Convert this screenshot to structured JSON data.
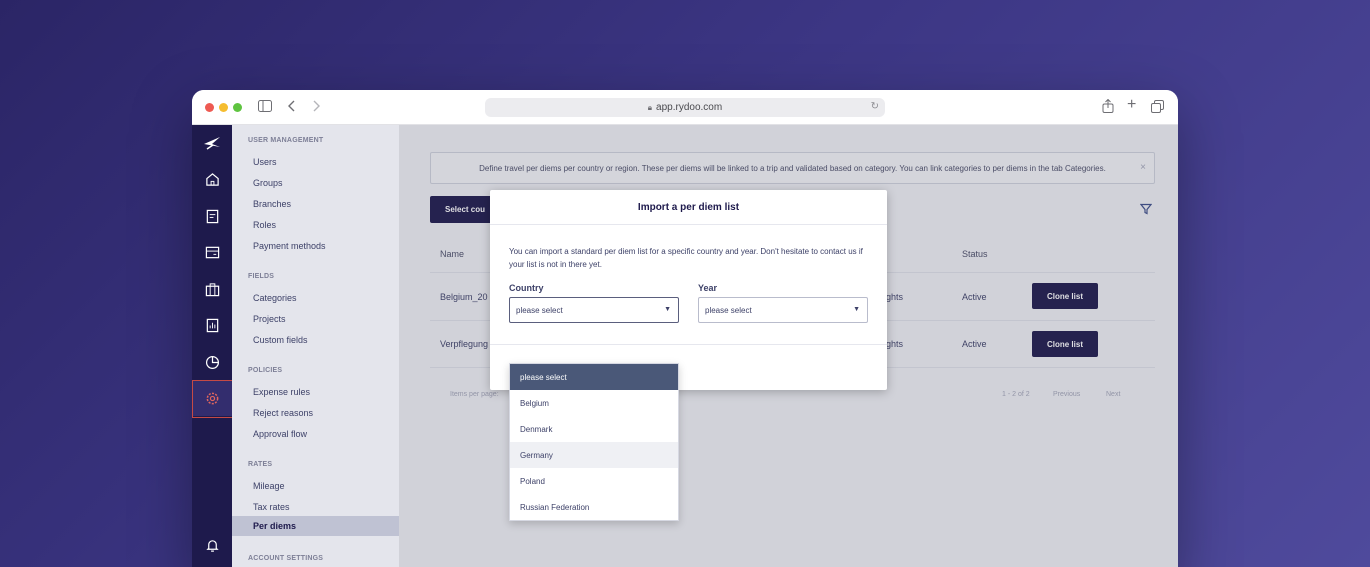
{
  "browser": {
    "url": "app.rydoo.com"
  },
  "menu": {
    "sections": [
      {
        "title": "USER MANAGEMENT",
        "items": [
          "Users",
          "Groups",
          "Branches",
          "Roles",
          "Payment methods"
        ]
      },
      {
        "title": "FIELDS",
        "items": [
          "Categories",
          "Projects",
          "Custom fields"
        ]
      },
      {
        "title": "POLICIES",
        "items": [
          "Expense rules",
          "Reject reasons",
          "Approval flow"
        ]
      },
      {
        "title": "RATES",
        "items": [
          "Mileage",
          "Tax rates",
          "Per diems"
        ]
      },
      {
        "title": "ACCOUNT SETTINGS",
        "items": []
      }
    ],
    "active_item": "Per diems"
  },
  "main": {
    "banner": "Define travel per diems per country or region. These per diems will be linked to a trip and validated based on category. You can link categories to per diems in the tab Categories.",
    "banner_close": "×",
    "select_button": "Select cou",
    "table": {
      "headers": {
        "name": "Name",
        "status": "Status"
      },
      "rows": [
        {
          "name": "Belgium_20",
          "col": "ghts",
          "status": "Active",
          "action": "Clone list"
        },
        {
          "name": "Verpflegung",
          "col": "ghts",
          "status": "Active",
          "action": "Clone list"
        }
      ]
    },
    "footer": {
      "items_per_page": "Items per page:",
      "range": "1 - 2 of 2",
      "previous": "Previous",
      "next": "Next"
    }
  },
  "modal": {
    "title": "Import a per diem list",
    "description": "You can import a standard per diem list for a specific country and year. Don't hesitate to contact us if your list is not in there yet.",
    "country_label": "Country",
    "country_value": "please select",
    "year_label": "Year",
    "year_value": "please select",
    "dropdown_options": [
      "please select",
      "Belgium",
      "Denmark",
      "Germany",
      "Poland",
      "Russian Federation"
    ],
    "dropdown_selected": "please select",
    "dropdown_hovered": "Germany"
  },
  "colors": {
    "background": "#3c3684",
    "rail": "#1e1a4c",
    "primary_button": "#1e1a4c",
    "active_indicator": "#c54a45",
    "option_selected": "#4a5878"
  }
}
